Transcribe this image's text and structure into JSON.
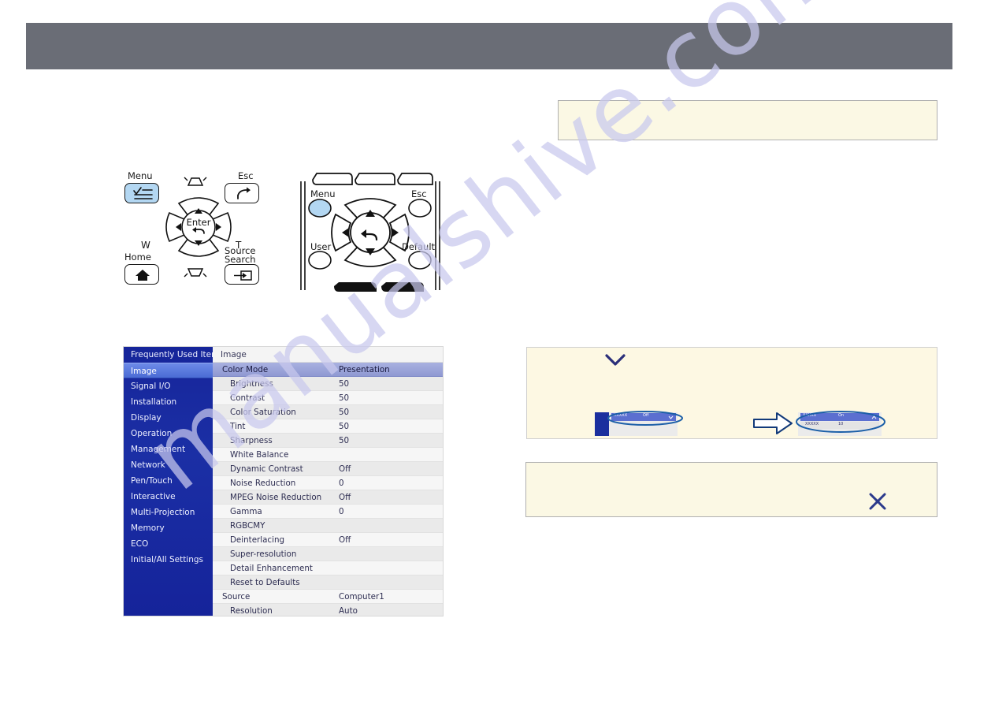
{
  "page": {
    "watermark": "manualshive.com",
    "header_color": "#6a6d76",
    "background": "#ffffff"
  },
  "control_panel": {
    "name": "projector-control-panel",
    "labels": {
      "menu": "Menu",
      "esc": "Esc",
      "home": "Home",
      "source_search_line1": "Source",
      "source_search_line2": "Search",
      "enter": "Enter",
      "wide": "W",
      "tele": "T"
    },
    "icons": {
      "menu": "menu-list-icon",
      "esc": "back-arrow-icon",
      "home": "home-icon",
      "source": "source-input-icon",
      "enter": "enter-return-icon",
      "up": "arrow-up-icon",
      "down": "arrow-down-icon",
      "left": "arrow-left-icon",
      "right": "arrow-right-icon",
      "keystone_top": "keystone-trapezoid-icon",
      "keystone_bottom": "keystone-trapezoid-icon"
    },
    "highlight_color": "#b3d7f2"
  },
  "remote": {
    "name": "projector-remote-control",
    "labels": {
      "menu": "Menu",
      "esc": "Esc",
      "user": "User",
      "default": "Default"
    },
    "icons": {
      "enter": "enter-return-icon",
      "up": "arrow-up-icon",
      "down": "arrow-down-icon",
      "left": "arrow-left-icon",
      "right": "arrow-right-icon"
    },
    "menu_button_color": "#b3d7f2"
  },
  "osd": {
    "title": "Image",
    "sidebar": {
      "selected": "Image",
      "items": [
        {
          "label": "Frequently Used Items"
        },
        {
          "label": "Image"
        },
        {
          "label": "Signal I/O"
        },
        {
          "label": "Installation"
        },
        {
          "label": "Display"
        },
        {
          "label": "Operation"
        },
        {
          "label": "Management"
        },
        {
          "label": "Network"
        },
        {
          "label": "Pen/Touch"
        },
        {
          "label": "Interactive"
        },
        {
          "label": "Multi-Projection"
        },
        {
          "label": "Memory"
        },
        {
          "label": "ECO"
        },
        {
          "label": "Initial/All Settings"
        }
      ]
    },
    "rows": [
      {
        "label": "Color Mode",
        "value": "Presentation",
        "indent": 1,
        "selected": true
      },
      {
        "label": "Brightness",
        "value": "50",
        "indent": 2
      },
      {
        "label": "Contrast",
        "value": "50",
        "indent": 2
      },
      {
        "label": "Color Saturation",
        "value": "50",
        "indent": 2
      },
      {
        "label": "Tint",
        "value": "50",
        "indent": 2
      },
      {
        "label": "Sharpness",
        "value": "50",
        "indent": 2
      },
      {
        "label": "White Balance",
        "value": "",
        "indent": 2
      },
      {
        "label": "Dynamic Contrast",
        "value": "Off",
        "indent": 2
      },
      {
        "label": "Noise Reduction",
        "value": "0",
        "indent": 2
      },
      {
        "label": "MPEG Noise Reduction",
        "value": "Off",
        "indent": 2
      },
      {
        "label": "Gamma",
        "value": "0",
        "indent": 2
      },
      {
        "label": "RGBCMY",
        "value": "",
        "indent": 2
      },
      {
        "label": "Deinterlacing",
        "value": "Off",
        "indent": 2
      },
      {
        "label": "Super-resolution",
        "value": "",
        "indent": 2
      },
      {
        "label": "Detail Enhancement",
        "value": "",
        "indent": 2
      },
      {
        "label": "Reset to Defaults",
        "value": "",
        "indent": 2
      },
      {
        "label": "Source",
        "value": "Computer1",
        "indent": 1
      },
      {
        "label": "Resolution",
        "value": "Auto",
        "indent": 2
      }
    ],
    "colors": {
      "sidebar": "#1b2fa5",
      "sidebar_selected": "#4f6fd8",
      "row_selected": "#9aa3d8",
      "panel": "#f0f0f0"
    }
  },
  "notes": {
    "top_box": {
      "name": "note-box-top",
      "text": ""
    },
    "middle_box": {
      "name": "note-box-middle",
      "chevron_icon": "chevron-down-icon",
      "arrow_icon": "right-arrow-icon",
      "before_menu": {
        "rows": [
          {
            "label": "XXXXX",
            "value": "Off",
            "marker": "chevron-down-icon",
            "selected": true
          }
        ]
      },
      "after_menu": {
        "rows": [
          {
            "label": "XXXXX",
            "value": "On",
            "marker": "chevron-up-icon",
            "selected": true
          },
          {
            "label": "XXXXX",
            "value": "10",
            "marker": "",
            "selected": false
          }
        ]
      }
    },
    "bottom_box": {
      "name": "note-box-bottom",
      "text": "",
      "icon": "x-close-icon"
    }
  }
}
